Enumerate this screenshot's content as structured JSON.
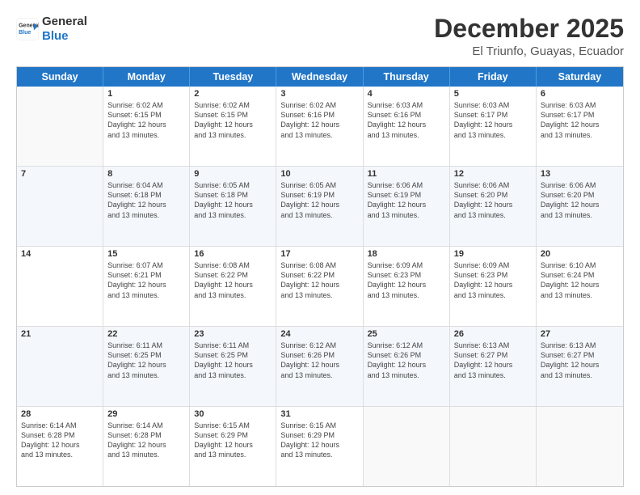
{
  "header": {
    "logo_general": "General",
    "logo_blue": "Blue",
    "title": "December 2025",
    "subtitle": "El Triunfo, Guayas, Ecuador"
  },
  "calendar": {
    "days_of_week": [
      "Sunday",
      "Monday",
      "Tuesday",
      "Wednesday",
      "Thursday",
      "Friday",
      "Saturday"
    ],
    "weeks": [
      [
        {
          "day": "",
          "info": ""
        },
        {
          "day": "1",
          "info": "Sunrise: 6:02 AM\nSunset: 6:15 PM\nDaylight: 12 hours\nand 13 minutes."
        },
        {
          "day": "2",
          "info": "Sunrise: 6:02 AM\nSunset: 6:15 PM\nDaylight: 12 hours\nand 13 minutes."
        },
        {
          "day": "3",
          "info": "Sunrise: 6:02 AM\nSunset: 6:16 PM\nDaylight: 12 hours\nand 13 minutes."
        },
        {
          "day": "4",
          "info": "Sunrise: 6:03 AM\nSunset: 6:16 PM\nDaylight: 12 hours\nand 13 minutes."
        },
        {
          "day": "5",
          "info": "Sunrise: 6:03 AM\nSunset: 6:17 PM\nDaylight: 12 hours\nand 13 minutes."
        },
        {
          "day": "6",
          "info": "Sunrise: 6:03 AM\nSunset: 6:17 PM\nDaylight: 12 hours\nand 13 minutes."
        }
      ],
      [
        {
          "day": "7",
          "info": ""
        },
        {
          "day": "8",
          "info": "Sunrise: 6:04 AM\nSunset: 6:18 PM\nDaylight: 12 hours\nand 13 minutes."
        },
        {
          "day": "9",
          "info": "Sunrise: 6:05 AM\nSunset: 6:18 PM\nDaylight: 12 hours\nand 13 minutes."
        },
        {
          "day": "10",
          "info": "Sunrise: 6:05 AM\nSunset: 6:19 PM\nDaylight: 12 hours\nand 13 minutes."
        },
        {
          "day": "11",
          "info": "Sunrise: 6:06 AM\nSunset: 6:19 PM\nDaylight: 12 hours\nand 13 minutes."
        },
        {
          "day": "12",
          "info": "Sunrise: 6:06 AM\nSunset: 6:20 PM\nDaylight: 12 hours\nand 13 minutes."
        },
        {
          "day": "13",
          "info": "Sunrise: 6:06 AM\nSunset: 6:20 PM\nDaylight: 12 hours\nand 13 minutes."
        }
      ],
      [
        {
          "day": "14",
          "info": ""
        },
        {
          "day": "15",
          "info": "Sunrise: 6:07 AM\nSunset: 6:21 PM\nDaylight: 12 hours\nand 13 minutes."
        },
        {
          "day": "16",
          "info": "Sunrise: 6:08 AM\nSunset: 6:22 PM\nDaylight: 12 hours\nand 13 minutes."
        },
        {
          "day": "17",
          "info": "Sunrise: 6:08 AM\nSunset: 6:22 PM\nDaylight: 12 hours\nand 13 minutes."
        },
        {
          "day": "18",
          "info": "Sunrise: 6:09 AM\nSunset: 6:23 PM\nDaylight: 12 hours\nand 13 minutes."
        },
        {
          "day": "19",
          "info": "Sunrise: 6:09 AM\nSunset: 6:23 PM\nDaylight: 12 hours\nand 13 minutes."
        },
        {
          "day": "20",
          "info": "Sunrise: 6:10 AM\nSunset: 6:24 PM\nDaylight: 12 hours\nand 13 minutes."
        }
      ],
      [
        {
          "day": "21",
          "info": ""
        },
        {
          "day": "22",
          "info": "Sunrise: 6:11 AM\nSunset: 6:25 PM\nDaylight: 12 hours\nand 13 minutes."
        },
        {
          "day": "23",
          "info": "Sunrise: 6:11 AM\nSunset: 6:25 PM\nDaylight: 12 hours\nand 13 minutes."
        },
        {
          "day": "24",
          "info": "Sunrise: 6:12 AM\nSunset: 6:26 PM\nDaylight: 12 hours\nand 13 minutes."
        },
        {
          "day": "25",
          "info": "Sunrise: 6:12 AM\nSunset: 6:26 PM\nDaylight: 12 hours\nand 13 minutes."
        },
        {
          "day": "26",
          "info": "Sunrise: 6:13 AM\nSunset: 6:27 PM\nDaylight: 12 hours\nand 13 minutes."
        },
        {
          "day": "27",
          "info": "Sunrise: 6:13 AM\nSunset: 6:27 PM\nDaylight: 12 hours\nand 13 minutes."
        }
      ],
      [
        {
          "day": "28",
          "info": "Sunrise: 6:14 AM\nSunset: 6:28 PM\nDaylight: 12 hours\nand 13 minutes."
        },
        {
          "day": "29",
          "info": "Sunrise: 6:14 AM\nSunset: 6:28 PM\nDaylight: 12 hours\nand 13 minutes."
        },
        {
          "day": "30",
          "info": "Sunrise: 6:15 AM\nSunset: 6:29 PM\nDaylight: 12 hours\nand 13 minutes."
        },
        {
          "day": "31",
          "info": "Sunrise: 6:15 AM\nSunset: 6:29 PM\nDaylight: 12 hours\nand 13 minutes."
        },
        {
          "day": "",
          "info": ""
        },
        {
          "day": "",
          "info": ""
        },
        {
          "day": "",
          "info": ""
        }
      ]
    ]
  }
}
